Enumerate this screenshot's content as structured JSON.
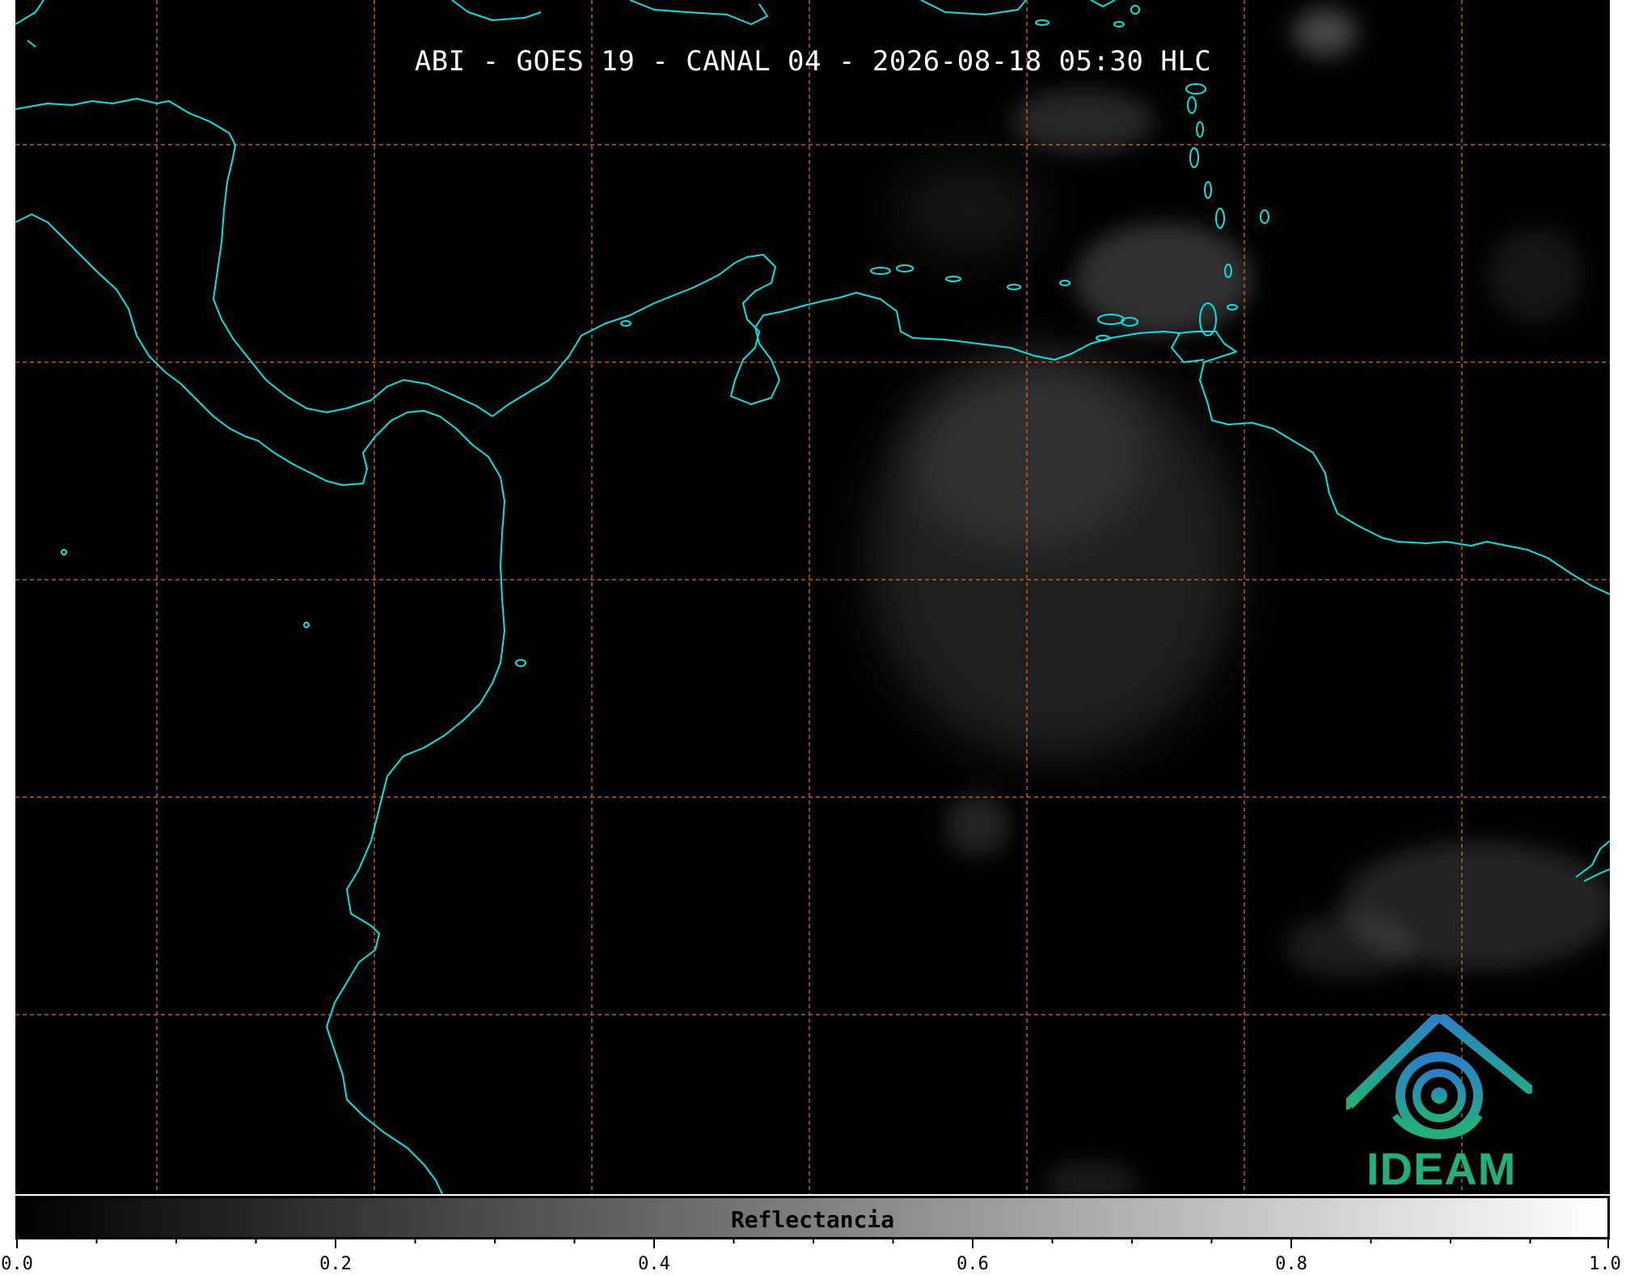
{
  "title": "ABI - GOES 19 - CANAL 04 - 2026-08-18 05:30 HLC",
  "colorbar": {
    "label": "Reflectancia",
    "min": 0.0,
    "max": 1.0,
    "ticks": [
      "0.0",
      "0.2",
      "0.4",
      "0.6",
      "0.8",
      "1.0"
    ],
    "gradient_start": "#000000",
    "gradient_end": "#ffffff"
  },
  "map": {
    "background": "#000000",
    "coastline_color": "#00e5e5",
    "gridline_color": "#d2691e",
    "gridline_style": "dashed",
    "cloud_color": "#9a9a9a"
  },
  "logo": {
    "text": "IDEAM",
    "icon": "ideam-logo-icon",
    "primary_color": "#22b07a",
    "secondary_color": "#2a7fc9"
  }
}
